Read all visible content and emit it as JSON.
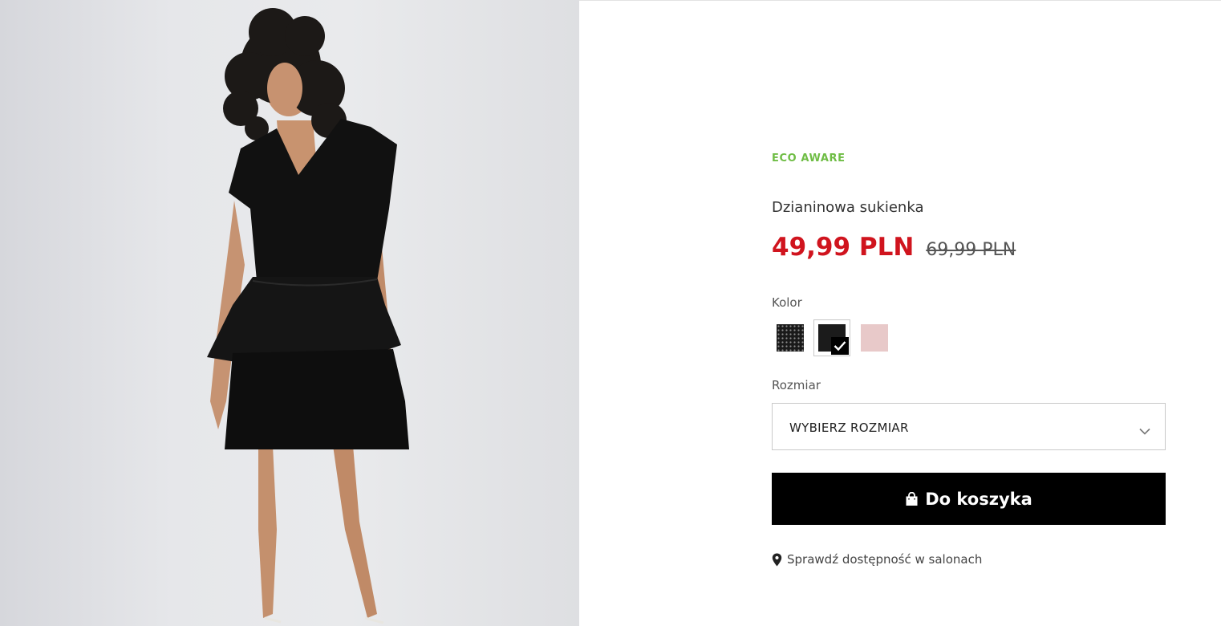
{
  "product": {
    "badge": "ECO AWARE",
    "name": "Dzianinowa sukienka",
    "price_current": "49,99 PLN",
    "price_old": "69,99 PLN"
  },
  "color_section": {
    "label": "Kolor",
    "swatches": [
      {
        "name": "black-dotted",
        "color": "#1a1a1a",
        "selected": false
      },
      {
        "name": "black",
        "color": "#1b1b1b",
        "selected": true
      },
      {
        "name": "pink",
        "color": "#e8c9c9",
        "selected": false
      }
    ]
  },
  "size_section": {
    "label": "Rozmiar",
    "select_value": "WYBIERZ ROZMIAR"
  },
  "cart_button": {
    "label": "Do koszyka",
    "icon": "shopping-bag-icon"
  },
  "store_availability": {
    "label": "Sprawdź dostępność w salonach",
    "icon": "map-pin-icon"
  },
  "colors": {
    "accent_green": "#6fbd45",
    "price_red": "#d0141e",
    "button_black": "#000000"
  }
}
